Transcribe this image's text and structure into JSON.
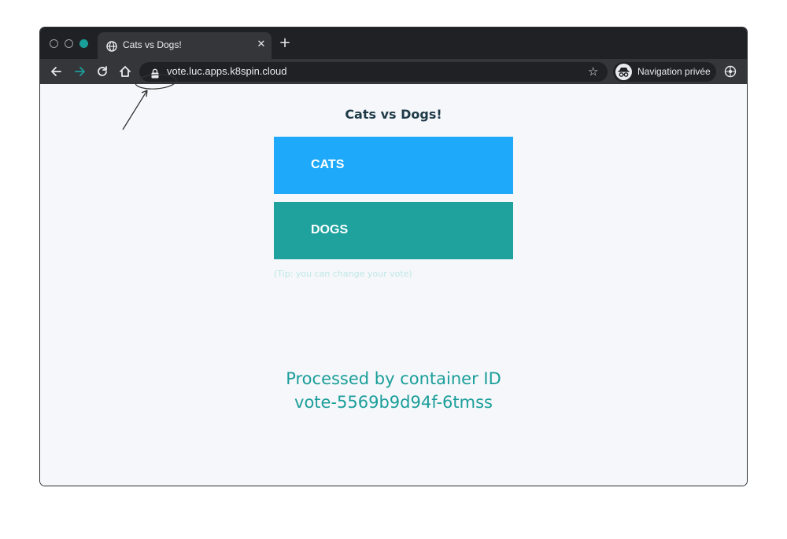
{
  "browser": {
    "tab": {
      "title": "Cats vs Dogs!",
      "close_icon": "close-icon",
      "favicon": "globe-icon"
    },
    "new_tab_icon": "plus-icon",
    "address_bar": {
      "url": "vote.luc.apps.k8spin.cloud",
      "lock_icon": "lock-icon",
      "bookmark_icon": "star-icon"
    },
    "profile": {
      "label": "Navigation privée",
      "icon": "incognito-icon"
    },
    "nav_icons": [
      "back-icon",
      "forward-icon",
      "reload-icon",
      "home-icon"
    ],
    "accent_color": "#1a9e9a"
  },
  "page": {
    "title": "Cats vs Dogs!",
    "options": [
      {
        "label": "CATS",
        "color": "#1fa9fb"
      },
      {
        "label": "DOGS",
        "color": "#1fa29e"
      }
    ],
    "tip": "(Tip: you can change your vote)",
    "processed_line1": "Processed by container ID",
    "processed_line2": "vote-5569b9d94f-6tmss"
  }
}
